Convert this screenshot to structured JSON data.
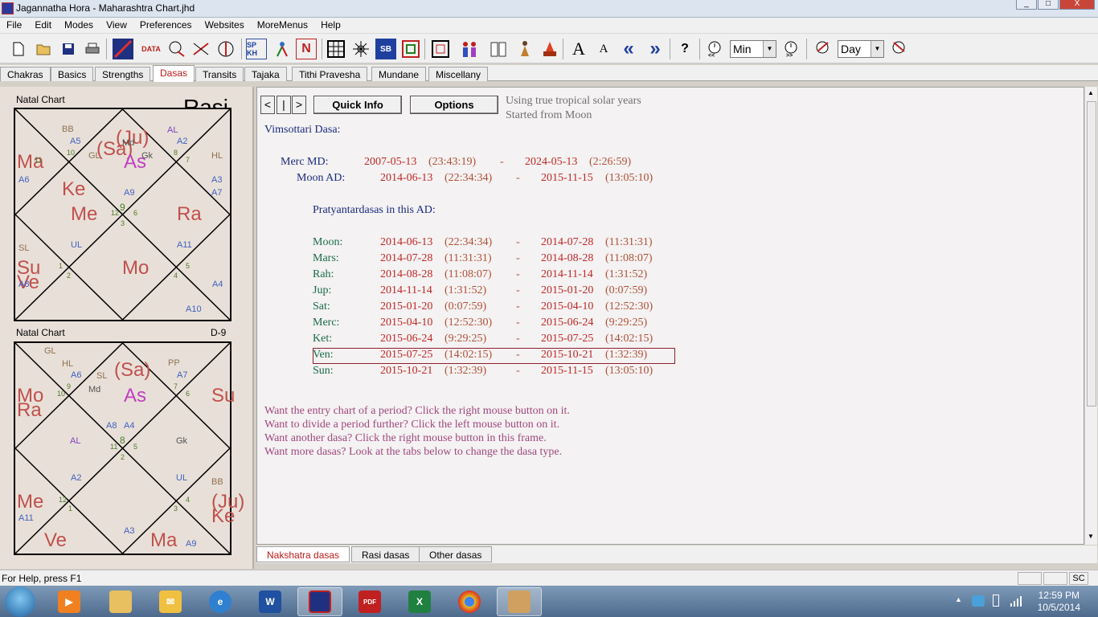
{
  "window": {
    "title": "Jagannatha Hora - Maharashtra Chart.jhd",
    "btn_min": "_",
    "btn_max": "□",
    "btn_close": "X"
  },
  "menu": [
    "File",
    "Edit",
    "Modes",
    "View",
    "Preferences",
    "Websites",
    "MoreMenus",
    "Help"
  ],
  "toolbar": {
    "data_label": "DATA",
    "sp_label": "SP KH",
    "n_label": "N",
    "sb_label": "SB",
    "font_big": "A",
    "font_small": "A",
    "back_label": "«",
    "fwd_label": "»",
    "help_label": "?",
    "step_unit": "Min",
    "step_unit2": "Day"
  },
  "tabs": [
    "Chakras",
    "Basics",
    "Strengths",
    "Dasas",
    "Transits",
    "Tajaka",
    "Tithi Pravesha",
    "Mundane",
    "Miscellany"
  ],
  "charts": {
    "rasi": {
      "label": "Natal Chart",
      "name": "Rasi",
      "ma": "Ma",
      "a6": "A6",
      "pp": "PP",
      "bb": "BB",
      "a5": "A5",
      "gl": "GL",
      "sa": "(Sa)",
      "ju": "(Ju)",
      "md": "Md",
      "as": "As",
      "gk": "Gk",
      "al": "AL",
      "a2": "A2",
      "hl": "HL",
      "a3": "A3",
      "a7": "A7",
      "ke": "Ke",
      "me": "Me",
      "a9": "A9",
      "ra": "Ra",
      "sl": "SL",
      "ul": "UL",
      "a11": "A11",
      "su": "Su",
      "ve": "Ve",
      "a8": "A8",
      "mo": "Mo",
      "a4": "A4",
      "a10": "A10",
      "n10": "10",
      "n11": "11",
      "n8": "8",
      "n7": "7",
      "n9": "9",
      "n12": "12",
      "n6": "6",
      "n3": "3",
      "n1": "1",
      "n2": "2",
      "n5": "5",
      "n4": "4"
    },
    "d9": {
      "label": "Natal Chart",
      "name": "D-9",
      "gl": "GL",
      "hl": "HL",
      "a6": "A6",
      "sl": "SL",
      "md": "Md",
      "sa": "(Sa)",
      "as": "As",
      "pp": "PP",
      "a7": "A7",
      "mo": "Mo",
      "ra": "Ra",
      "su": "Su",
      "a8": "A8",
      "a4": "A4",
      "al": "AL",
      "gk": "Gk",
      "a2": "A2",
      "ul": "UL",
      "bb": "BB",
      "me": "Me",
      "a11": "A11",
      "ju": "(Ju)",
      "ke": "Ke",
      "ve": "Ve",
      "a3": "A3",
      "ma": "Ma",
      "a9": "A9",
      "n10": "10",
      "n9": "9",
      "n7": "7",
      "n6": "6",
      "n8": "8",
      "n11": "11",
      "n5": "5",
      "n2": "2",
      "n12": "12",
      "n1": "1",
      "n3": "3",
      "n4": "4"
    }
  },
  "dasa": {
    "nav_prev": "<",
    "nav_cur": "|",
    "nav_next": ">",
    "quick_info": "Quick Info",
    "options": "Options",
    "info1": "Using true tropical solar years",
    "info2": "Started from Moon",
    "heading": "Vimsottari Dasa:",
    "md": {
      "label": "Merc MD:",
      "start": "2007-05-13",
      "start_time": "(23:43:19)",
      "dash": "-",
      "end": "2024-05-13",
      "end_time": "(2:26:59)"
    },
    "ad": {
      "label": "Moon AD:",
      "start": "2014-06-13",
      "start_time": "(22:34:34)",
      "dash": "-",
      "end": "2015-11-15",
      "end_time": "(13:05:10)"
    },
    "pd_heading": "Pratyantardasas in this AD:",
    "rows": [
      {
        "label": "Moon:",
        "start": "2014-06-13",
        "start_time": "(22:34:34)",
        "dash": "-",
        "end": "2014-07-28",
        "end_time": "(11:31:31)"
      },
      {
        "label": "Mars:",
        "start": "2014-07-28",
        "start_time": "(11:31:31)",
        "dash": "-",
        "end": "2014-08-28",
        "end_time": "(11:08:07)"
      },
      {
        "label": "Rah:",
        "start": "2014-08-28",
        "start_time": "(11:08:07)",
        "dash": "-",
        "end": "2014-11-14",
        "end_time": "(1:31:52)"
      },
      {
        "label": "Jup:",
        "start": "2014-11-14",
        "start_time": "(1:31:52)",
        "dash": "-",
        "end": "2015-01-20",
        "end_time": "(0:07:59)"
      },
      {
        "label": "Sat:",
        "start": "2015-01-20",
        "start_time": "(0:07:59)",
        "dash": "-",
        "end": "2015-04-10",
        "end_time": "(12:52:30)"
      },
      {
        "label": "Merc:",
        "start": "2015-04-10",
        "start_time": "(12:52:30)",
        "dash": "-",
        "end": "2015-06-24",
        "end_time": "(9:29:25)"
      },
      {
        "label": "Ket:",
        "start": "2015-06-24",
        "start_time": "(9:29:25)",
        "dash": "-",
        "end": "2015-07-25",
        "end_time": "(14:02:15)"
      },
      {
        "label": "Ven:",
        "start": "2015-07-25",
        "start_time": "(14:02:15)",
        "dash": "-",
        "end": "2015-10-21",
        "end_time": "(1:32:39)"
      },
      {
        "label": "Sun:",
        "start": "2015-10-21",
        "start_time": "(1:32:39)",
        "dash": "-",
        "end": "2015-11-15",
        "end_time": "(13:05:10)"
      }
    ],
    "help": [
      "Want the entry chart of a period? Click the right mouse button on it.",
      "Want to divide a period further? Click the left mouse button on it.",
      "Want another dasa? Click the right mouse button in this frame.",
      "Want more dasas? Look at the tabs below to change the dasa type."
    ]
  },
  "bottom_tabs": [
    "Nakshatra dasas",
    "Rasi dasas",
    "Other dasas"
  ],
  "status": {
    "text": "For Help, press F1",
    "sc": "SC"
  },
  "taskbar": {
    "time": "12:59 PM",
    "date": "10/5/2014",
    "pdf": "PDF",
    "w": "W"
  }
}
